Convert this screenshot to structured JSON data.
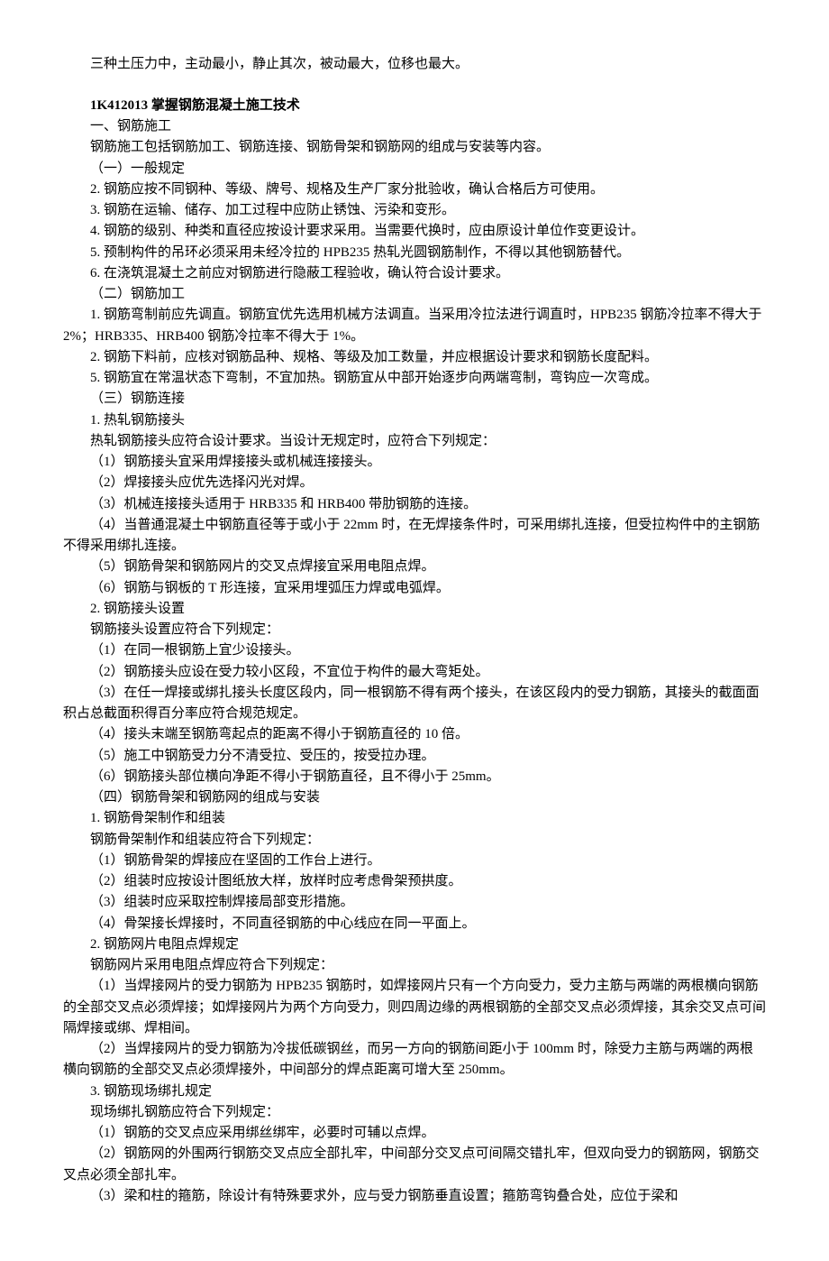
{
  "p1": "三种土压力中，主动最小，静止其次，被动最大，位移也最大。",
  "h1": "1K412013 掌握钢筋混凝土施工技术",
  "s1_title": "一、钢筋施工",
  "s1_intro": "钢筋施工包括钢筋加工、钢筋连接、钢筋骨架和钢筋网的组成与安装等内容。",
  "s1_1_title": "（一）一般规定",
  "s1_1_i2": "2. 钢筋应按不同钢种、等级、牌号、规格及生产厂家分批验收，确认合格后方可使用。",
  "s1_1_i3": "3. 钢筋在运输、储存、加工过程中应防止锈蚀、污染和变形。",
  "s1_1_i4": "4. 钢筋的级别、种类和直径应按设计要求采用。当需要代换时，应由原设计单位作变更设计。",
  "s1_1_i5": "5. 预制构件的吊环必须采用未经冷拉的 HPB235 热轧光圆钢筋制作，不得以其他钢筋替代。",
  "s1_1_i6": "6. 在浇筑混凝土之前应对钢筋进行隐蔽工程验收，确认符合设计要求。",
  "s1_2_title": "（二）钢筋加工",
  "s1_2_i1": "1. 钢筋弯制前应先调直。钢筋宜优先选用机械方法调直。当采用冷拉法进行调直时，HPB235 钢筋冷拉率不得大于 2%；HRB335、HRB400 钢筋冷拉率不得大于 1%。",
  "s1_2_i2": "2. 钢筋下料前，应核对钢筋品种、规格、等级及加工数量，并应根据设计要求和钢筋长度配料。",
  "s1_2_i5": "5. 钢筋宜在常温状态下弯制，不宜加热。钢筋宜从中部开始逐步向两端弯制，弯钩应一次弯成。",
  "s1_3_title": "（三）钢筋连接",
  "s1_3_1_title": "1. 热轧钢筋接头",
  "s1_3_1_intro": "热轧钢筋接头应符合设计要求。当设计无规定时，应符合下列规定：",
  "s1_3_1_i1": "（1）钢筋接头宜采用焊接接头或机械连接接头。",
  "s1_3_1_i2": "（2）焊接接头应优先选择闪光对焊。",
  "s1_3_1_i3": "（3）机械连接接头适用于 HRB335 和 HRB400 带肋钢筋的连接。",
  "s1_3_1_i4": "（4）当普通混凝土中钢筋直径等于或小于 22mm 时，在无焊接条件时，可采用绑扎连接，但受拉构件中的主钢筋不得采用绑扎连接。",
  "s1_3_1_i5": "（5）钢筋骨架和钢筋网片的交叉点焊接宜采用电阻点焊。",
  "s1_3_1_i6": "（6）钢筋与钢板的 T 形连接，宜采用埋弧压力焊或电弧焊。",
  "s1_3_2_title": "2. 钢筋接头设置",
  "s1_3_2_intro": "钢筋接头设置应符合下列规定：",
  "s1_3_2_i1": "（1）在同一根钢筋上宜少设接头。",
  "s1_3_2_i2": "（2）钢筋接头应设在受力较小区段，不宜位于构件的最大弯矩处。",
  "s1_3_2_i3": "（3）在任一焊接或绑扎接头长度区段内，同一根钢筋不得有两个接头，在该区段内的受力钢筋，其接头的截面面积占总截面积得百分率应符合规范规定。",
  "s1_3_2_i4": "（4）接头末端至钢筋弯起点的距离不得小于钢筋直径的 10 倍。",
  "s1_3_2_i5": "（5）施工中钢筋受力分不清受拉、受压的，按受拉办理。",
  "s1_3_2_i6": "（6）钢筋接头部位横向净距不得小于钢筋直径，且不得小于 25mm。",
  "s1_4_title": "（四）钢筋骨架和钢筋网的组成与安装",
  "s1_4_1_title": "1. 钢筋骨架制作和组装",
  "s1_4_1_intro": "钢筋骨架制作和组装应符合下列规定：",
  "s1_4_1_i1": "（1）钢筋骨架的焊接应在坚固的工作台上进行。",
  "s1_4_1_i2": "（2）组装时应按设计图纸放大样，放样时应考虑骨架预拱度。",
  "s1_4_1_i3": "（3）组装时应采取控制焊接局部变形措施。",
  "s1_4_1_i4": "（4）骨架接长焊接时，不同直径钢筋的中心线应在同一平面上。",
  "s1_4_2_title": "2. 钢筋网片电阻点焊规定",
  "s1_4_2_intro": "钢筋网片采用电阻点焊应符合下列规定：",
  "s1_4_2_i1": "（1）当焊接网片的受力钢筋为 HPB235 钢筋时，如焊接网片只有一个方向受力，受力主筋与两端的两根横向钢筋的全部交叉点必须焊接；如焊接网片为两个方向受力，则四周边缘的两根钢筋的全部交叉点必须焊接，其余交叉点可间隔焊接或绑、焊相间。",
  "s1_4_2_i2": "（2）当焊接网片的受力钢筋为冷拔低碳钢丝，而另一方向的钢筋间距小于 100mm 时，除受力主筋与两端的两根横向钢筋的全部交叉点必须焊接外，中间部分的焊点距离可增大至 250mm。",
  "s1_4_3_title": "3. 钢筋现场绑扎规定",
  "s1_4_3_intro": "现场绑扎钢筋应符合下列规定：",
  "s1_4_3_i1": "（1）钢筋的交叉点应采用绑丝绑牢，必要时可辅以点焊。",
  "s1_4_3_i2": "（2）钢筋网的外围两行钢筋交叉点应全部扎牢，中间部分交叉点可间隔交错扎牢，但双向受力的钢筋网，钢筋交叉点必须全部扎牢。",
  "s1_4_3_i3": "（3）梁和柱的箍筋，除设计有特殊要求外，应与受力钢筋垂直设置；箍筋弯钩叠合处，应位于梁和"
}
